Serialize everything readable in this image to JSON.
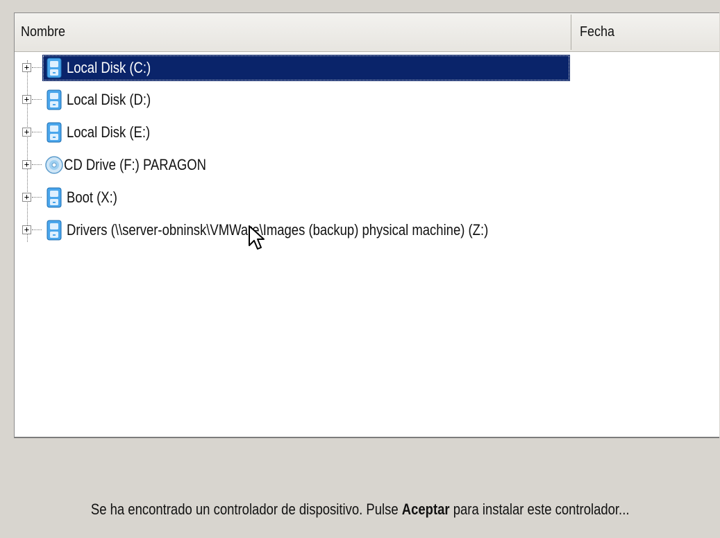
{
  "columns": {
    "name": "Nombre",
    "date": "Fecha"
  },
  "tree": {
    "items": [
      {
        "label": "Local Disk (C:)",
        "icon": "hard-disk-icon",
        "selected": true
      },
      {
        "label": "Local Disk (D:)",
        "icon": "hard-disk-icon",
        "selected": false
      },
      {
        "label": "Local Disk (E:)",
        "icon": "hard-disk-icon",
        "selected": false
      },
      {
        "label": "CD Drive (F:) PARAGON",
        "icon": "cd-drive-icon",
        "selected": false
      },
      {
        "label": "Boot (X:)",
        "icon": "hard-disk-icon",
        "selected": false
      },
      {
        "label": "Drivers (\\\\server-obninsk\\VMWare\\Images (backup) physical machine) (Z:)",
        "icon": "network-drive-icon",
        "selected": false
      }
    ],
    "expander_symbol": "+"
  },
  "status": {
    "prefix": "Se ha encontrado un controlador de dispositivo. Pulse ",
    "bold": "Aceptar",
    "suffix": " para instalar este controlador..."
  },
  "colors": {
    "selection": "#0a246a",
    "background": "#d8d5cf",
    "drive_icon": "#3f9be2"
  }
}
